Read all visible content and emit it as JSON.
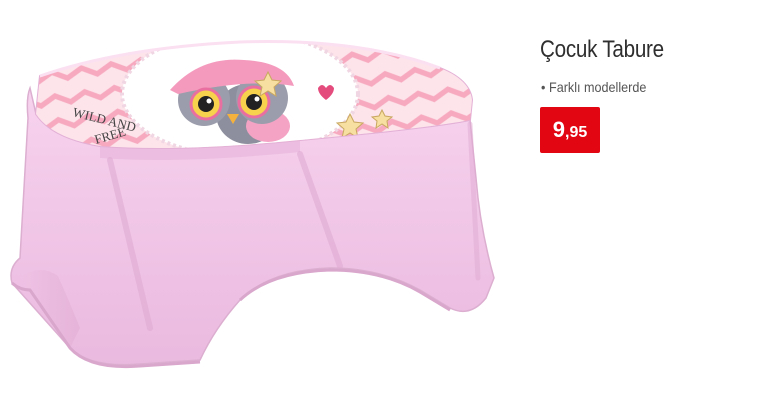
{
  "product": {
    "title": "Çocuk Tabure",
    "feature": "Farklı modellerde",
    "price": {
      "integer": "9",
      "separator": ",",
      "decimal": "95"
    },
    "image": {
      "label_text": "WILD AND FREE",
      "subject": "pink stool with owl illustration"
    }
  },
  "colors": {
    "price_badge": "#e20613",
    "stool": "#f4c6e8",
    "lid_stripe": "#f7a9bf"
  }
}
